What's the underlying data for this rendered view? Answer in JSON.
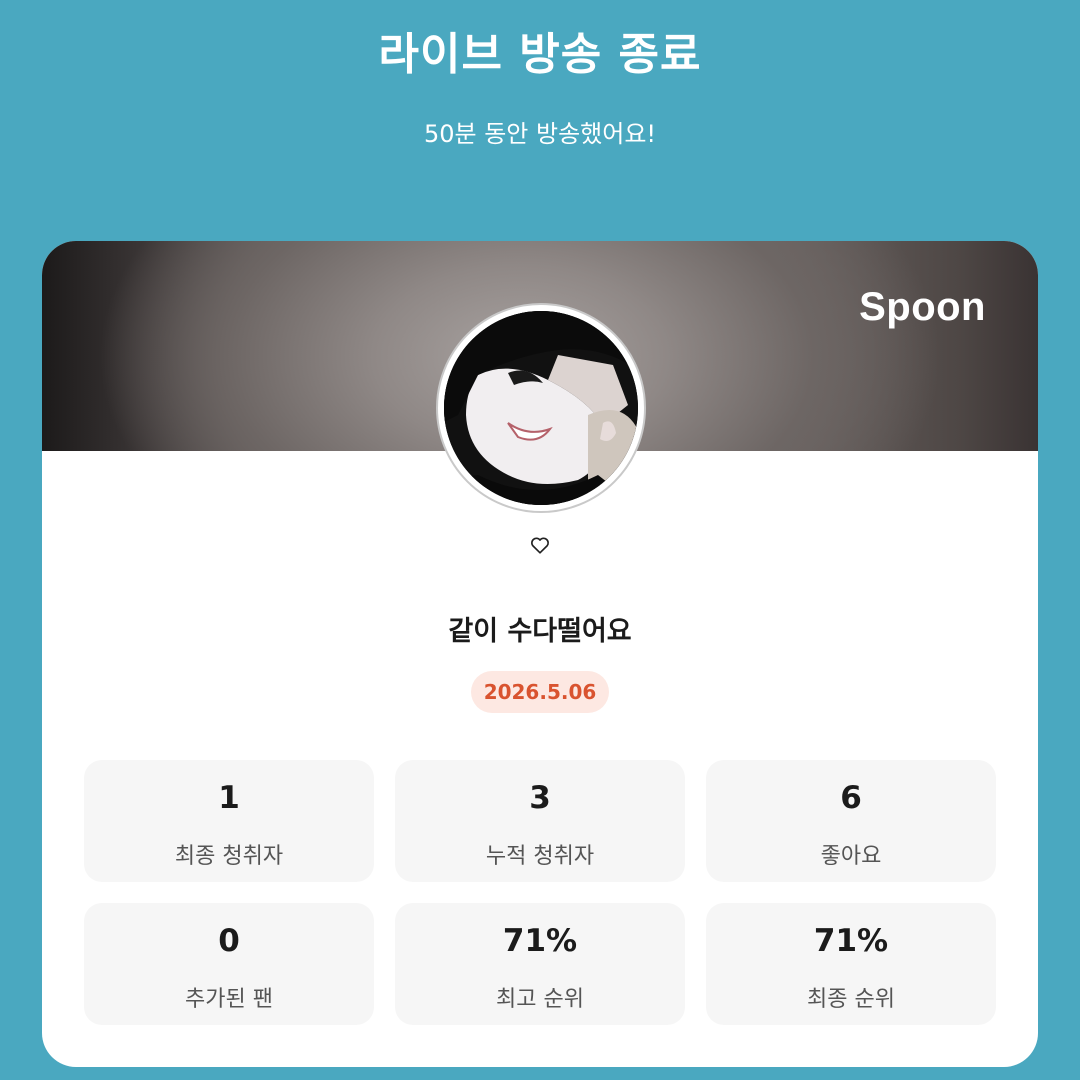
{
  "header": {
    "title": "라이브 방송 종료",
    "subtitle": "50분 동안 방송했어요!"
  },
  "card": {
    "brand": "Spoon",
    "avatar_icon": "profile-photo",
    "favorite_icon": "heart-outline-icon",
    "room_title": "같이 수다떨어요",
    "date": "2026.5.06",
    "stats": [
      {
        "value": "1",
        "label": "최종 청취자"
      },
      {
        "value": "3",
        "label": "누적 청취자"
      },
      {
        "value": "6",
        "label": "좋아요"
      },
      {
        "value": "0",
        "label": "추가된 팬"
      },
      {
        "value": "71%",
        "label": "최고 순위"
      },
      {
        "value": "71%",
        "label": "최종 순위"
      }
    ]
  },
  "colors": {
    "background": "#4aa8c0",
    "card": "#ffffff",
    "date_text": "#d9532f",
    "date_badge": "#fde8e2",
    "stat_tile": "#f6f6f6"
  }
}
